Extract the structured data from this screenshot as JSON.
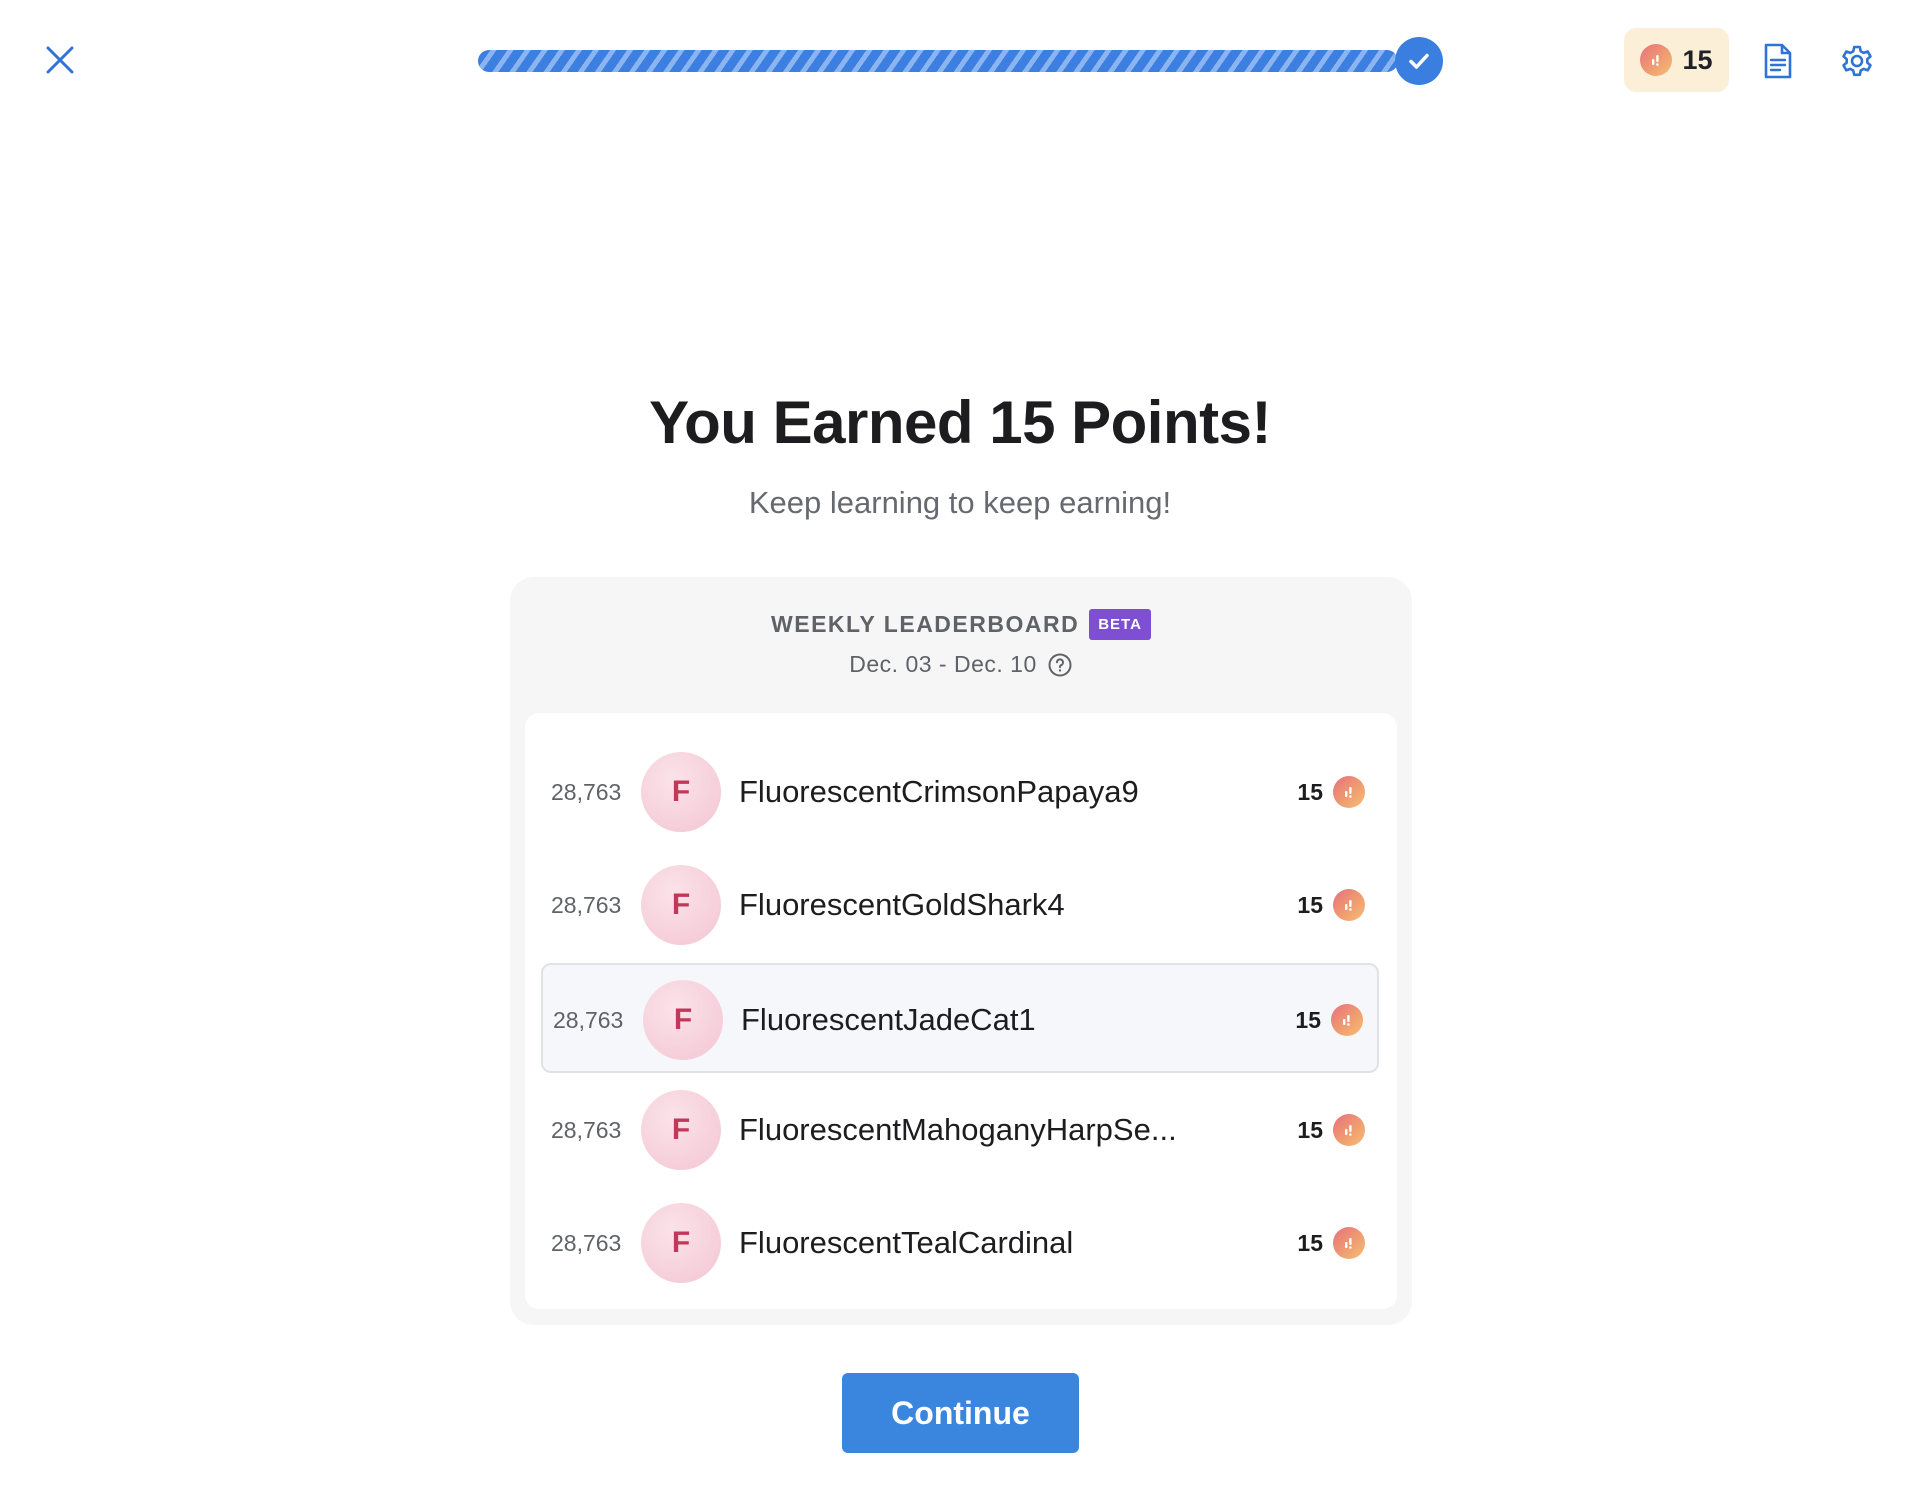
{
  "header": {
    "close_icon": "close-icon",
    "progress_percent": 100,
    "progress_complete_icon": "check-icon",
    "points": "15",
    "points_icon": "coin-icon",
    "notes_icon": "document-icon",
    "settings_icon": "gear-icon"
  },
  "main": {
    "title": "You Earned 15 Points!",
    "subtitle": "Keep learning to keep earning!"
  },
  "leaderboard": {
    "title": "WEEKLY LEADERBOARD",
    "badge": "BETA",
    "date_range": "Dec. 03 - Dec. 10",
    "help_icon": "question-circle-icon",
    "rows": [
      {
        "rank": "28,763",
        "initial": "F",
        "name": "FluorescentCrimsonPapaya9",
        "points": "15",
        "current": false
      },
      {
        "rank": "28,763",
        "initial": "F",
        "name": "FluorescentGoldShark4",
        "points": "15",
        "current": false
      },
      {
        "rank": "28,763",
        "initial": "F",
        "name": "FluorescentJadeCat1",
        "points": "15",
        "current": true
      },
      {
        "rank": "28,763",
        "initial": "F",
        "name": "FluorescentMahoganyHarpSe...",
        "points": "15",
        "current": false
      },
      {
        "rank": "28,763",
        "initial": "F",
        "name": "FluorescentTealCardinal",
        "points": "15",
        "current": false
      }
    ]
  },
  "footer": {
    "continue_label": "Continue"
  },
  "colors": {
    "primary": "#3a86df",
    "progress": "#3d7fe0",
    "badge_bg": "#fcefd8",
    "beta": "#7e4fd3",
    "avatar_text": "#c2375a"
  }
}
